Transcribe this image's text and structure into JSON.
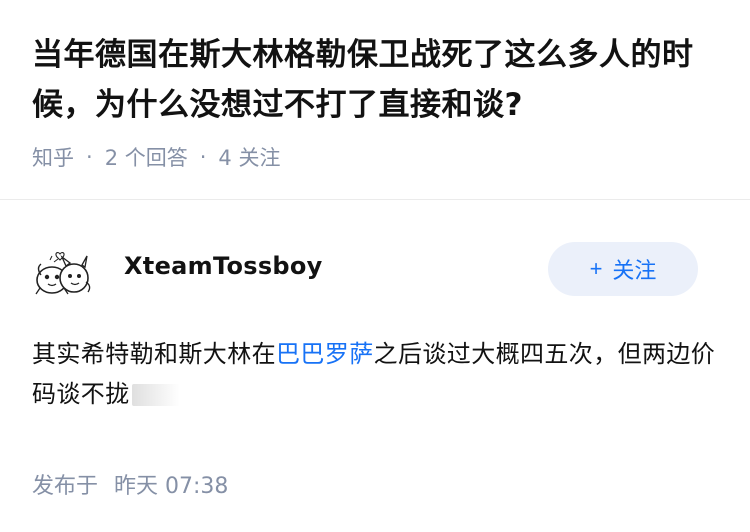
{
  "question": {
    "title": "当年德国在斯大林格勒保卫战死了这么多人的时候，为什么没想过不打了直接和谈?",
    "source": "知乎",
    "separator": "·",
    "answers_count": "2 个回答",
    "followers_count": "4 关注"
  },
  "answer": {
    "author_name": "XteamTossboy",
    "follow_button": {
      "plus": "+",
      "label": "关注"
    },
    "text_part1": "其实希特勒和斯大林在",
    "text_link": "巴巴罗萨",
    "text_part2": "之后谈过大概四五次，但两边价码谈不拢",
    "posted_label": "发布于",
    "posted_time": "昨天 07:38"
  },
  "colors": {
    "accent": "#1772f6",
    "meta": "#8590a6",
    "follow_bg": "#ebf0fa",
    "text": "#121212"
  },
  "icons": {
    "avatar": "doodle-creatures-avatar"
  }
}
